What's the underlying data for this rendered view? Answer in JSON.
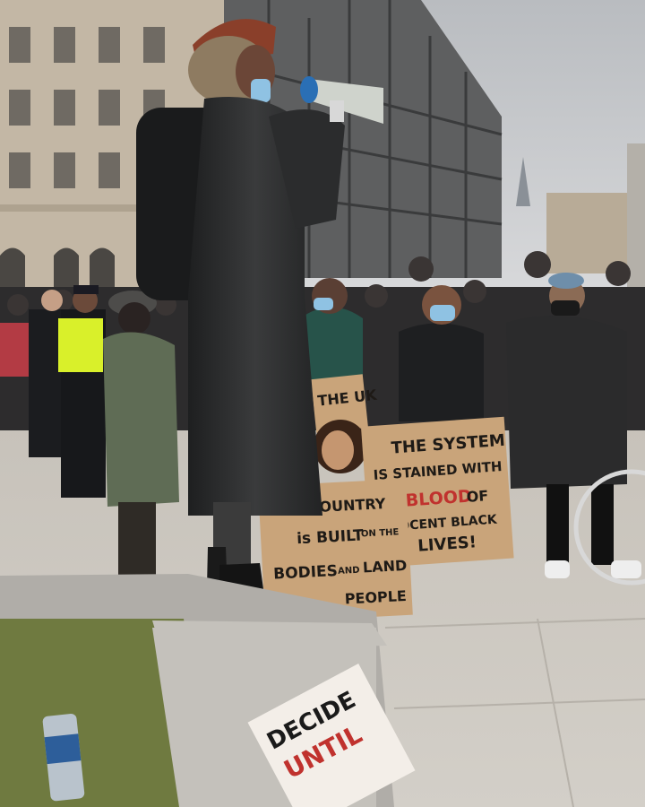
{
  "photo": {
    "signs": [
      {
        "id": "sign-uk",
        "text": "THE UK"
      },
      {
        "id": "sign-system",
        "lines": [
          "THE SYSTEM",
          "IS STAINED WITH",
          "BLOOD",
          "OF",
          "INNOCENT BLACK",
          "LIVES!"
        ]
      },
      {
        "id": "sign-country",
        "lines": [
          "THIS COUNTRY",
          "is BUILT",
          "ON THE",
          "BODIES",
          "AND",
          "LAND",
          "PEOPLE"
        ]
      },
      {
        "id": "sign-ledge",
        "lines": [
          "DECIDE",
          "UNTIL"
        ]
      }
    ],
    "colors": {
      "sky": "#c9cbce",
      "pavement": "#cfcac2",
      "coat": "#2a2b2c",
      "cardboard": "#c9a47a",
      "mask": "#8fc2e3",
      "red_text": "#c0322e",
      "police_vest": "#d9f02a"
    }
  }
}
